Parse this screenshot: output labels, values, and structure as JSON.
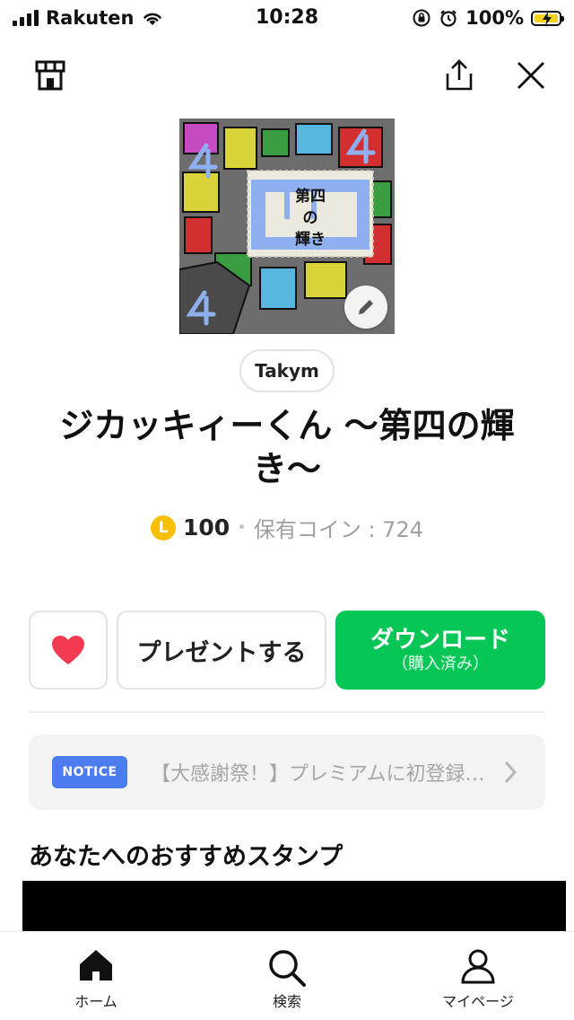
{
  "status_bar": {
    "carrier": "Rakuten",
    "time": "10:28",
    "battery": "100%"
  },
  "top_bar": {
    "shop_icon": "shop-icon",
    "share_icon": "share-icon",
    "close_icon": "close-icon"
  },
  "sticker": {
    "image_text": "第四の輝き",
    "author": "Takym",
    "title": "ジカッキィーくん 〜第四の輝き〜",
    "coin_symbol": "L",
    "price": "100",
    "separator": "•",
    "owned_coins": "保有コイン : 724"
  },
  "actions": {
    "like_icon": "heart-icon",
    "present_label": "プレゼントする",
    "download_label": "ダウンロード",
    "download_sub": "（購入済み）"
  },
  "notice": {
    "tag": "NOTICE",
    "text": "【大感謝祭！】プレミアムに初登録…"
  },
  "recommend": {
    "title": "あなたへのおすすめスタンプ"
  },
  "tabs": [
    {
      "label": "ホーム",
      "icon": "home-icon"
    },
    {
      "label": "検索",
      "icon": "search-icon"
    },
    {
      "label": "マイページ",
      "icon": "person-icon"
    }
  ],
  "colors": {
    "accent": "#06c755",
    "notice_tag": "#4c7cf0",
    "coin": "#f7c000",
    "heart": "#f33a52"
  }
}
